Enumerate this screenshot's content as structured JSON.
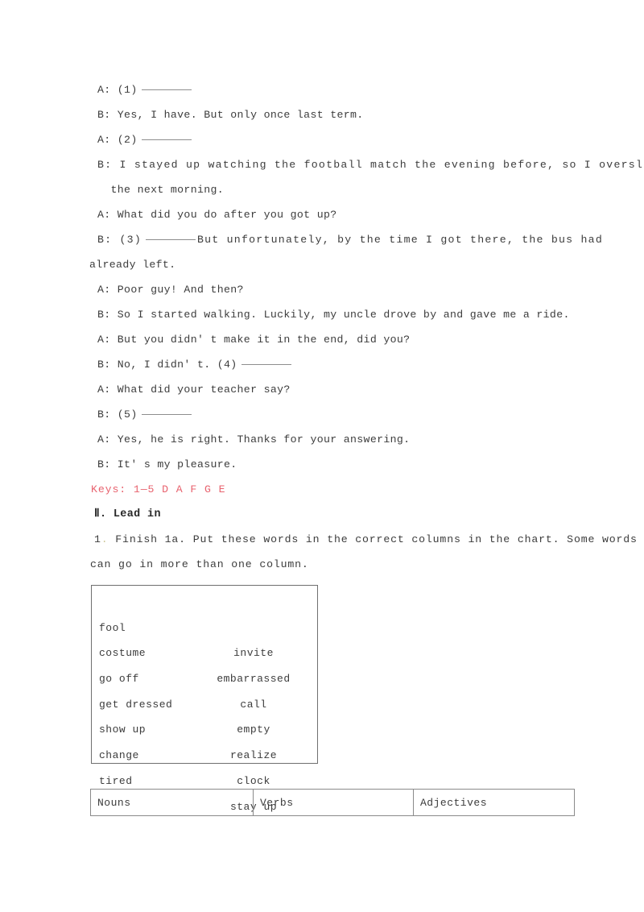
{
  "document": {
    "dialogue": [
      {
        "id": "d1",
        "text": "A: (1)",
        "blank": true,
        "style": "indent"
      },
      {
        "id": "d2",
        "text": "B: Yes, I have. But only once last term.",
        "blank": false,
        "style": "indent"
      },
      {
        "id": "d3",
        "text": "A: (2)",
        "blank": true,
        "style": "indent"
      },
      {
        "id": "d4",
        "text": "B: I stayed up watching the football match the evening before, so I overslept",
        "blank": false,
        "style": "indent-wide"
      },
      {
        "id": "d5",
        "text": "  the next morning.",
        "blank": false,
        "style": "indent"
      },
      {
        "id": "d6",
        "text": "A: What did you do after you got up?",
        "blank": false,
        "style": "indent"
      },
      {
        "id": "d7",
        "text": "B: (3)",
        "blank": true,
        "after_blank": "But unfortunately, by the time I got there, the bus had",
        "style": "indent-wide"
      },
      {
        "id": "d8",
        "text": "already left.",
        "blank": false,
        "style": "flush"
      },
      {
        "id": "d9",
        "text": "A: Poor guy! And then?",
        "blank": false,
        "style": "indent"
      },
      {
        "id": "d10",
        "text": "B: So I started walking. Luckily, my uncle drove by and gave me a ride.",
        "blank": false,
        "style": "indent"
      },
      {
        "id": "d11",
        "text": "A: But you didn' t make it in the end, did you?",
        "blank": false,
        "style": "indent"
      },
      {
        "id": "d12",
        "text": "B: No, I didn' t. (4)",
        "blank": true,
        "style": "indent"
      },
      {
        "id": "d13",
        "text": "A: What did your teacher say?",
        "blank": false,
        "style": "indent"
      },
      {
        "id": "d14",
        "text": "B: (5)",
        "blank": true,
        "style": "indent"
      },
      {
        "id": "d15",
        "text": "A: Yes, he is right. Thanks for your answering.",
        "blank": false,
        "style": "indent"
      },
      {
        "id": "d16",
        "text": "B: It' s my pleasure.",
        "blank": false,
        "style": "indent"
      }
    ],
    "keys_line": "Keys: 1—5 D A F G E",
    "section_heading": "Ⅱ. Lead in",
    "task": {
      "number": "1",
      "dot": ".",
      "text_line1": " Finish 1a. Put these words in the correct columns in the chart. Some words",
      "text_line2": "can go in more than one column."
    },
    "word_bank": {
      "rows": [
        {
          "left": "fool",
          "right": "invite"
        },
        {
          "left": "costume",
          "right": "embarrassed"
        },
        {
          "left": "go off",
          "right": "call"
        },
        {
          "left": "get dressed",
          "right": "empty"
        },
        {
          "left": "show up",
          "right": "realize"
        },
        {
          "left": "change",
          "right": "clock"
        },
        {
          "left": "tired",
          "right": "stay up"
        }
      ]
    },
    "category_table": {
      "headers": [
        "Nouns",
        "Verbs",
        "Adjectives"
      ]
    },
    "colors": {
      "keys_red": "#e8636f",
      "text": "#3c3c3c",
      "border": "#8a8a8a"
    }
  }
}
